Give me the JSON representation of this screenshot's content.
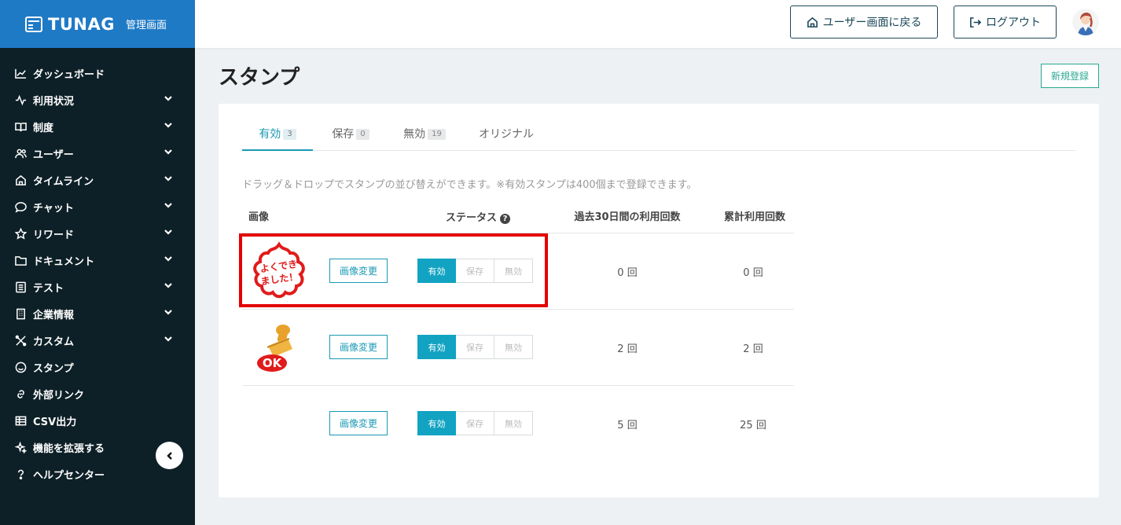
{
  "brand": {
    "name": "TUNAG",
    "subtitle": "管理画面"
  },
  "sidebar": {
    "items": [
      {
        "label": "ダッシュボード",
        "icon": "chart-icon",
        "expandable": false
      },
      {
        "label": "利用状況",
        "icon": "activity-icon",
        "expandable": true
      },
      {
        "label": "制度",
        "icon": "book-icon",
        "expandable": true
      },
      {
        "label": "ユーザー",
        "icon": "users-icon",
        "expandable": true
      },
      {
        "label": "タイムライン",
        "icon": "home-icon",
        "expandable": true
      },
      {
        "label": "チャット",
        "icon": "chat-icon",
        "expandable": true
      },
      {
        "label": "リワード",
        "icon": "star-icon",
        "expandable": true
      },
      {
        "label": "ドキュメント",
        "icon": "folder-icon",
        "expandable": true
      },
      {
        "label": "テスト",
        "icon": "checklist-icon",
        "expandable": true
      },
      {
        "label": "企業情報",
        "icon": "building-icon",
        "expandable": true
      },
      {
        "label": "カスタム",
        "icon": "tools-icon",
        "expandable": true
      },
      {
        "label": "スタンプ",
        "icon": "smile-icon",
        "expandable": false
      },
      {
        "label": "外部リンク",
        "icon": "link-icon",
        "expandable": false
      },
      {
        "label": "CSV出力",
        "icon": "table-icon",
        "expandable": false
      },
      {
        "label": "機能を拡張する",
        "icon": "sparkle-icon",
        "expandable": false
      },
      {
        "label": "ヘルプセンター",
        "icon": "help-icon",
        "expandable": false
      }
    ]
  },
  "header": {
    "user_screen_label": "ユーザー画面に戻る",
    "logout_label": "ログアウト"
  },
  "page": {
    "title": "スタンプ",
    "new_button": "新規登録",
    "tabs": [
      {
        "label": "有効",
        "count": "3",
        "active": true
      },
      {
        "label": "保存",
        "count": "0",
        "active": false
      },
      {
        "label": "無効",
        "count": "19",
        "active": false
      },
      {
        "label": "オリジナル",
        "count": "",
        "active": false
      }
    ],
    "description": "ドラッグ＆ドロップでスタンプの並び替えができます。※有効スタンプは400個まで登録できます。",
    "columns": {
      "image": "画像",
      "status": "ステータス",
      "last30": "過去30日間の利用回数",
      "total": "累計利用回数"
    },
    "rows": [
      {
        "stamp_text_1": "よくでき",
        "stamp_text_2": "ました！",
        "change_label": "画像変更",
        "status": [
          "有効",
          "保存",
          "無効"
        ],
        "last30": "0 回",
        "total": "0 回"
      },
      {
        "stamp_text": "OK",
        "change_label": "画像変更",
        "status": [
          "有効",
          "保存",
          "無効"
        ],
        "last30": "2 回",
        "total": "2 回"
      },
      {
        "change_label": "画像変更",
        "status": [
          "有効",
          "保存",
          "無効"
        ],
        "last30": "5 回",
        "total": "25 回"
      }
    ]
  },
  "colors": {
    "accent": "#12a3c2",
    "brand": "#1f7ac6",
    "sidebar": "#0e2027",
    "highlight": "#e40000"
  }
}
